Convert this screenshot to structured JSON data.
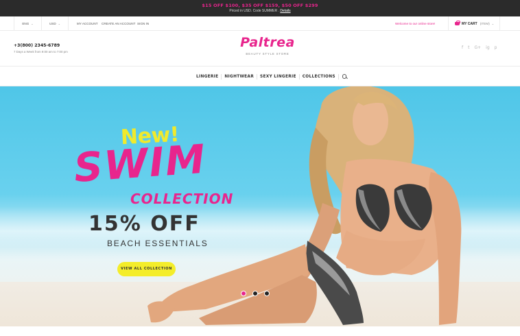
{
  "promo": {
    "line1": "$15 OFF $100, $35 OFF $159, $50 OFF $299",
    "line2_text": "Priced in USD. Code SUMMER .",
    "line2_link": "Details"
  },
  "utility": {
    "language": "ENG",
    "currency": "USD",
    "links": [
      "MY ACCOUNT",
      "CREATE AN ACCOUNT",
      "SIGN IN"
    ],
    "welcome": "Welcome to our online store!",
    "cart_label": "MY CART",
    "cart_count": "(ITEM)"
  },
  "header": {
    "phone": "+3(800) 2345-6789",
    "hours": "7 Days a Week from 9:00 am to 7:00 pm",
    "logo": "Paltrea",
    "tagline": "Beauty Style Store",
    "socials": [
      "f",
      "t",
      "G+",
      "ig",
      "p"
    ]
  },
  "nav": {
    "items": [
      "Lingerie",
      "Nightwear",
      "Sexy Lingerie",
      "Collections"
    ]
  },
  "hero": {
    "new": "New!",
    "headline": "SWIM",
    "sub": "COLLECTION",
    "offer": "15% OFF",
    "tag": "BEACH ESSENTIALS",
    "cta": "VIEW ALL COLLECTION",
    "active_slide": 1,
    "slides": 3
  },
  "colors": {
    "accent": "#e8258d",
    "highlight": "#f4ed2a",
    "dark": "#2b2b2b"
  }
}
